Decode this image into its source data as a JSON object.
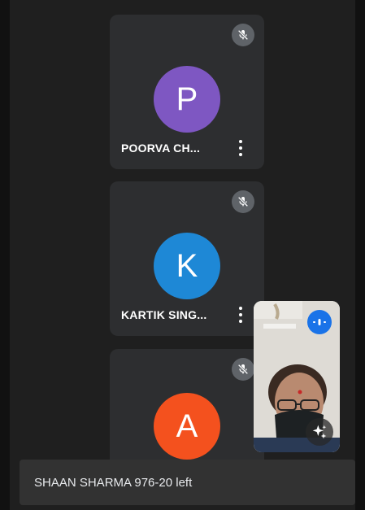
{
  "participants": [
    {
      "name": "POORVA CH...",
      "initial": "P",
      "avatar_color": "#7e57c2",
      "muted": true
    },
    {
      "name": "KARTIK SING...",
      "initial": "K",
      "avatar_color": "#1e88d6",
      "muted": true
    },
    {
      "name": "",
      "initial": "A",
      "avatar_color": "#f4511e",
      "muted": true
    }
  ],
  "icons": {
    "mute": "mic-off-icon",
    "more": "more-vert-icon",
    "audio": "audio-level-icon",
    "effects": "sparkle-effects-icon"
  },
  "toast": {
    "text": "SHAAN SHARMA 976-20 left"
  },
  "colors": {
    "background": "#1f1f1f",
    "tile": "#2d2e30",
    "accent": "#1a73e8"
  }
}
